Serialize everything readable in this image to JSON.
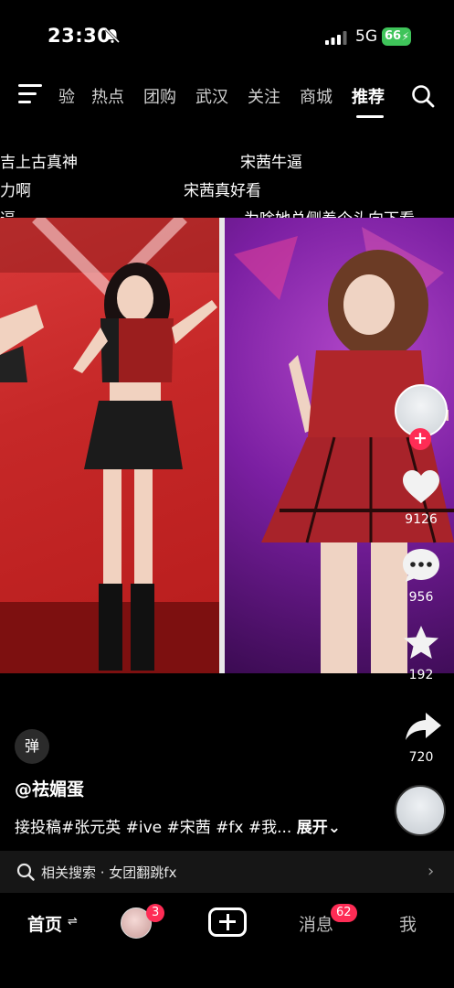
{
  "status_bar": {
    "time": "23:30",
    "network": "5G",
    "battery": "66",
    "icons": [
      "bell-mute-icon",
      "signal-icon",
      "charging-bolt-icon"
    ]
  },
  "top_nav": {
    "tabs": [
      "验",
      "热点",
      "团购",
      "武汉",
      "关注",
      "商城",
      "推荐"
    ],
    "active_tab": "推荐",
    "icons": [
      "menu-icon",
      "search-icon"
    ]
  },
  "danmaku": [
    "吉上古真神",
    "宋茜牛逼",
    "力啊",
    "宋茜真好看",
    "逼",
    "为啥她总侧着个头向下看"
  ],
  "actions": {
    "likes": "9126",
    "comments": "956",
    "favorites": "192",
    "shares": "720",
    "follow_symbol": "+"
  },
  "caption": {
    "danmu_toggle": "弹",
    "author": "@祛媚蛋",
    "description": "接投稿#张元英 #ive #宋茜 #fx #我... ",
    "expand": "展开⌄"
  },
  "related_search": {
    "label": "相关搜索 · 女团翻跳fx",
    "chevron": "›"
  },
  "bottom_nav": {
    "home": "首页",
    "home_refresh": "⇌",
    "friends_badge": "3",
    "messages": "消息",
    "messages_badge": "62",
    "me": "我"
  },
  "colors": {
    "accent": "#fe2c55",
    "battery": "#3fc45a",
    "background": "#000000"
  }
}
